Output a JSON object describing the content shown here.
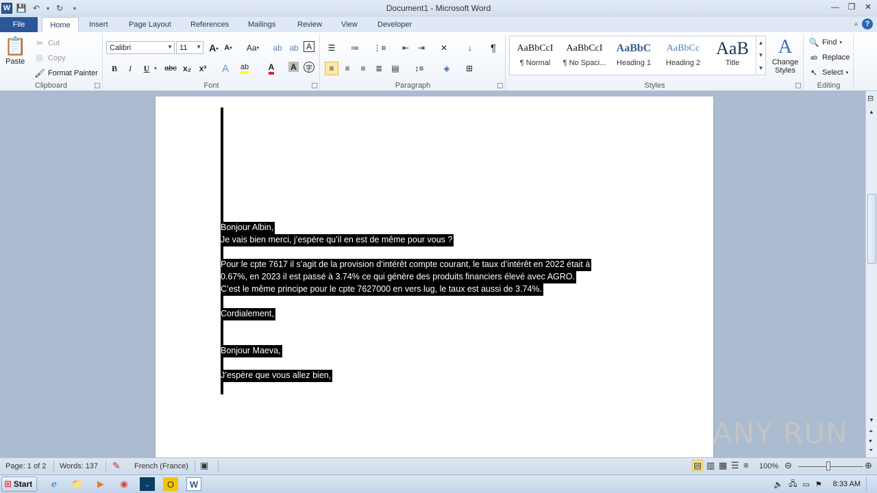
{
  "window": {
    "title": "Document1 - Microsoft Word"
  },
  "tabs": [
    "File",
    "Home",
    "Insert",
    "Page Layout",
    "References",
    "Mailings",
    "Review",
    "View",
    "Developer"
  ],
  "clipboard": {
    "paste": "Paste",
    "cut": "Cut",
    "copy": "Copy",
    "format_painter": "Format Painter",
    "label": "Clipboard"
  },
  "font": {
    "name": "Calibri",
    "size": "11",
    "label": "Font",
    "bold": "B",
    "italic": "I",
    "underline": "U",
    "strike": "abc",
    "sub": "x₂",
    "sup": "x²",
    "grow": "A",
    "shrink": "A",
    "case": "Aa",
    "clear": "A",
    "color_a": "A",
    "char_border": "A"
  },
  "paragraph": {
    "label": "Paragraph",
    "pilcrow": "¶"
  },
  "styles": {
    "label": "Styles",
    "items": [
      {
        "preview": "AaBbCcI",
        "name": "¶ Normal"
      },
      {
        "preview": "AaBbCcI",
        "name": "¶ No Spaci..."
      },
      {
        "preview": "AaBbC",
        "name": "Heading 1"
      },
      {
        "preview": "AaBbCc",
        "name": "Heading 2"
      },
      {
        "preview": "AaB",
        "name": "Title"
      }
    ],
    "change": "Change Styles"
  },
  "editing": {
    "label": "Editing",
    "find": "Find",
    "replace": "Replace",
    "select": "Select"
  },
  "document": {
    "lines": [
      "Bonjour Albin,",
      "Je vais bien merci, j’espère qu’il en est de même pour vous ?",
      "Pour le cpte 7617 il s’agit de la provision d’intérêt compte courant, le taux d’intérêt en 2022 était à",
      "0.67%, en 2023 il est passé à 3.74% ce qui génère des produits financiers élevé avec AGRO.",
      "C’est le même principe pour le cpte 7627000 en vers lug, le taux est aussi de 3.74%.",
      "Cordialement,",
      "Bonjour Maeva,",
      "J’espère que vous allez bien,"
    ]
  },
  "status": {
    "page": "Page: 1 of 2",
    "words": "Words: 137",
    "language": "French (France)",
    "zoom": "100%",
    "zoom_level": 1.0
  },
  "watermark": "ANY RUN",
  "taskbar": {
    "start": "Start",
    "time": "8:33 AM"
  },
  "colors": {
    "file_tab": "#2b579a",
    "selection": "#000000",
    "selection_text": "#ffffff",
    "font_color": "#e02020",
    "highlight": "#ffff00"
  }
}
